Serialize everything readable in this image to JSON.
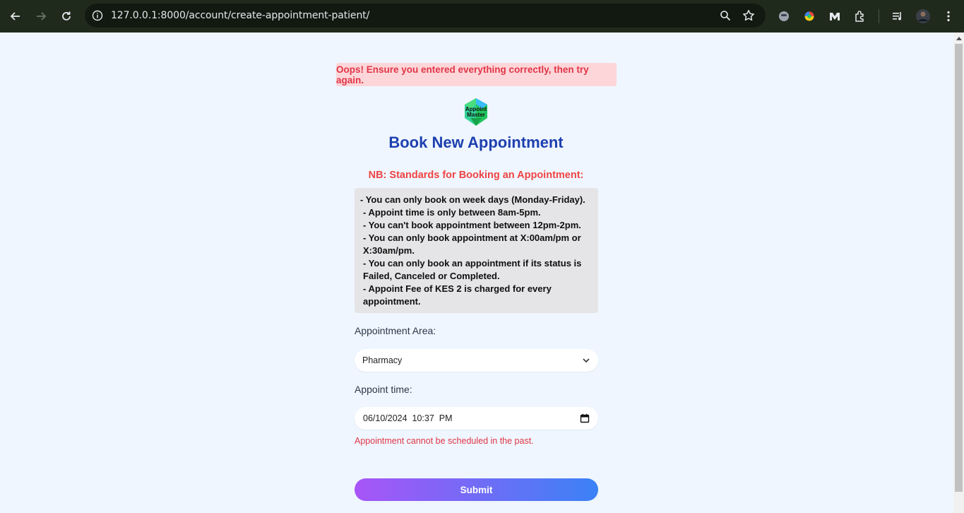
{
  "browser": {
    "url_host": "127.0.0.1",
    "url_rest": ":8000/account/create-appointment-patient/"
  },
  "alert": {
    "message": "Oops! Ensure you entered everything correctly, then try again.",
    "background": "#fdd6d9",
    "color": "#e03546"
  },
  "logo": {
    "line1": "Appoint",
    "line2": "Master"
  },
  "page": {
    "title": "Book New Appointment",
    "nb_title": "NB: Standards for Booking an Appointment:"
  },
  "rules": [
    "- You can only book on week days (Monday-Friday).",
    "- Appoint time is only between 8am-5pm.",
    "- You can't book appointment between 12pm-2pm.",
    "- You can only book appointment at X:00am/pm or",
    "X:30am/pm.",
    "- You can only book an appointment if its status is",
    "Failed, Canceled or Completed.",
    "- Appoint Fee of KES 2 is charged for every",
    "appointment."
  ],
  "form": {
    "area_label": "Appointment Area:",
    "area_value": "Pharmacy",
    "time_label": "Appoint time:",
    "time_value": "06/10/2024  10:37  PM",
    "time_error": "Appointment cannot be scheduled in the past.",
    "submit_label": "Submit"
  },
  "colors": {
    "accent_title": "#1e40af",
    "warning": "#ef4444",
    "page_bg": "#eff6ff"
  }
}
